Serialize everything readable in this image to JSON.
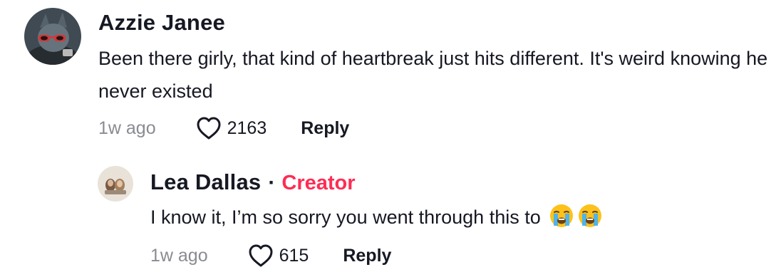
{
  "comments": [
    {
      "username": "Azzie Janee",
      "text": "Been there girly, that kind of heartbreak just hits different. It's weird knowing he never existed",
      "time": "1w ago",
      "likes": "2163",
      "reply_label": "Reply",
      "avatar_icon": "user-avatar"
    },
    {
      "username": "Lea Dallas",
      "separator": "·",
      "badge": "Creator",
      "text": "I know it, I’m so sorry you went through this to",
      "emoji": [
        "loudly-crying-face",
        "loudly-crying-face"
      ],
      "time": "1w ago",
      "likes": "615",
      "reply_label": "Reply",
      "avatar_icon": "creator-avatar"
    }
  ],
  "colors": {
    "text": "#161823",
    "muted": "#8a8b91",
    "creator_badge": "#fe2c55",
    "background": "#ffffff"
  },
  "icons": {
    "like": "heart-outline-icon"
  }
}
